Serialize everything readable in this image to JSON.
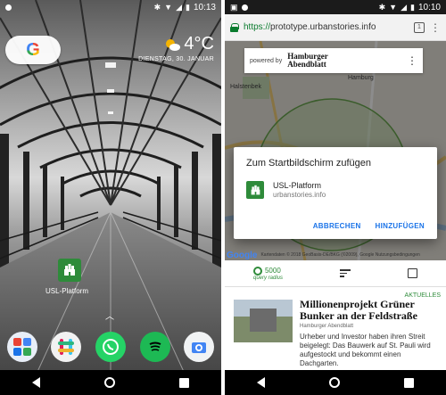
{
  "left_phone": {
    "status": {
      "time": "10:13"
    },
    "weather": {
      "temperature": "4°C",
      "date": "DIENSTAG, 30. JANUAR"
    },
    "home_app": {
      "label": "USL-Platform"
    }
  },
  "right_phone": {
    "status": {
      "time": "10:10"
    },
    "browser": {
      "scheme": "https://",
      "host": "prototype.urbanstories.info",
      "tab_count": "1"
    },
    "powered_by": {
      "label": "powered by",
      "brand_line1": "Hamburger",
      "brand_line2": "Abendblatt"
    },
    "map": {
      "labels": [
        "Halstenbek",
        "Hamburg"
      ],
      "attribution": "Kartendaten © 2018 GeoBasis-DE/BKG (©2009), Google Nutzungsbedingungen"
    },
    "dialog": {
      "title": "Zum Startbildschirm zufügen",
      "app_name": "USL-Platform",
      "app_url": "urbanstories.info",
      "cancel_label": "ABBRECHEN",
      "add_label": "HINZUFÜGEN"
    },
    "query": {
      "value": "5000",
      "label": "query radius"
    },
    "article": {
      "tag": "AKTUELLES",
      "title": "Millionenprojekt Grüner Bunker an der Feldstraße",
      "source": "Hamburger Abendblatt",
      "text": "Urheber und Investor haben ihren Streit beigelegt: Das Bauwerk auf St. Pauli wird aufgestockt und bekommt einen Dachgarten."
    }
  },
  "colors": {
    "accent_green": "#2e8b3a",
    "link_blue": "#1a73e8",
    "secure_green": "#0a7b2e"
  }
}
